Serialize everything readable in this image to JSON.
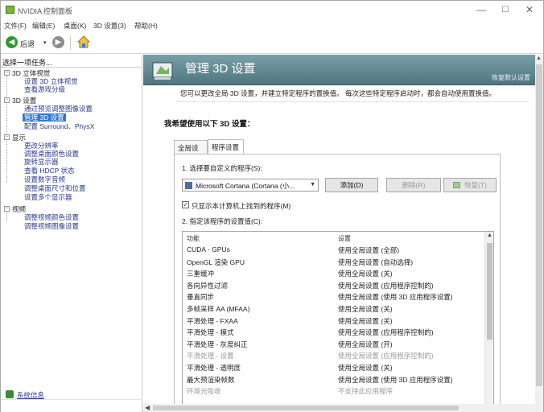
{
  "window": {
    "title": "NVIDIA 控制面板",
    "minimize": "—",
    "maximize": "☐",
    "close": "✕"
  },
  "menu": [
    "文件(F)",
    "编辑(E)",
    "桌面(K)",
    "3D 设置(3)",
    "帮助(H)"
  ],
  "toolbar": {
    "back_label": "后退",
    "back_dropdown": "▾"
  },
  "left": {
    "task_header": "选择一项任务...",
    "tree": [
      {
        "label": "3D 立体视觉",
        "type": "cat"
      },
      {
        "label": "设置 3D 立体视觉",
        "type": "link"
      },
      {
        "label": "查看游戏分级",
        "type": "link"
      },
      {
        "label": "3D 设置",
        "type": "cat"
      },
      {
        "label": "通过预览调整图像设置",
        "type": "link"
      },
      {
        "label": "管理 3D 设置",
        "type": "sel"
      },
      {
        "label": "配置 Surround、PhysX",
        "type": "link"
      },
      {
        "label": "显示",
        "type": "cat"
      },
      {
        "label": "更改分辨率",
        "type": "link"
      },
      {
        "label": "调整桌面颜色设置",
        "type": "link"
      },
      {
        "label": "旋转显示器",
        "type": "link"
      },
      {
        "label": "查看 HDCP 状态",
        "type": "link"
      },
      {
        "label": "设置数字音频",
        "type": "link"
      },
      {
        "label": "调整桌面尺寸和位置",
        "type": "link"
      },
      {
        "label": "设置多个显示器",
        "type": "link"
      },
      {
        "label": "视频",
        "type": "cat"
      },
      {
        "label": "调整视频颜色设置",
        "type": "link"
      },
      {
        "label": "调整视频图像设置",
        "type": "link"
      }
    ],
    "system_info": "系统信息"
  },
  "main": {
    "title": "管理 3D 设置",
    "restore_defaults": "恢复默认设置",
    "description": "您可以更改全局 3D 设置，并建立特定程序的置换值。 每次这些特定程序启动时，都会自动使用置换值。",
    "question": "我希望使用以下 3D 设置：",
    "tabs": [
      "全局设置",
      "程序设置"
    ],
    "step1": "1. 选择要自定义的程序(S):",
    "program_selected": "Microsoft Cortana (Cortana (小...",
    "add_button": "添加(D)",
    "delete_button": "删除(R)",
    "restore_button": "恢复(T)",
    "checkbox_checked": "✓",
    "checkbox_label": "只显示本计算机上找到的程序(M)",
    "step2": "2. 指定该程序的设置值(C):",
    "table": {
      "col_function": "功能",
      "col_setting": "设置",
      "rows": [
        {
          "f": "CUDA - GPUs",
          "v": "使用全局设置 (全部)",
          "dim": false
        },
        {
          "f": "OpenGL 渲染 GPU",
          "v": "使用全局设置 (自动选择)",
          "dim": false
        },
        {
          "f": "三重缓冲",
          "v": "使用全局设置 (关)",
          "dim": false
        },
        {
          "f": "各向异性过滤",
          "v": "使用全局设置 (应用程序控制的)",
          "dim": false
        },
        {
          "f": "垂直同步",
          "v": "使用全局设置 (使用 3D 应用程序设置)",
          "dim": false
        },
        {
          "f": "多帧采样 AA (MFAA)",
          "v": "使用全局设置 (关)",
          "dim": false
        },
        {
          "f": "平滑处理 - FXAA",
          "v": "使用全局设置 (关)",
          "dim": false
        },
        {
          "f": "平滑处理 - 模式",
          "v": "使用全局设置 (应用程序控制的)",
          "dim": false
        },
        {
          "f": "平滑处理 - 灰度纠正",
          "v": "使用全局设置 (开)",
          "dim": false
        },
        {
          "f": "平滑处理 - 设置",
          "v": "使用全局设置 (应用程序控制的)",
          "dim": true
        },
        {
          "f": "平滑处理 - 透明度",
          "v": "使用全局设置 (关)",
          "dim": false
        },
        {
          "f": "最大预渲染帧数",
          "v": "使用全局设置 (使用 3D 应用程序设置)",
          "dim": false
        },
        {
          "f": "环境光吸收",
          "v": "不支持此应用程序",
          "dim": true
        }
      ]
    }
  },
  "colors": {
    "accent": "#3178d4",
    "banner": "#5f8690",
    "link": "#2a3a8a",
    "nvidia_green": "#78b834"
  }
}
